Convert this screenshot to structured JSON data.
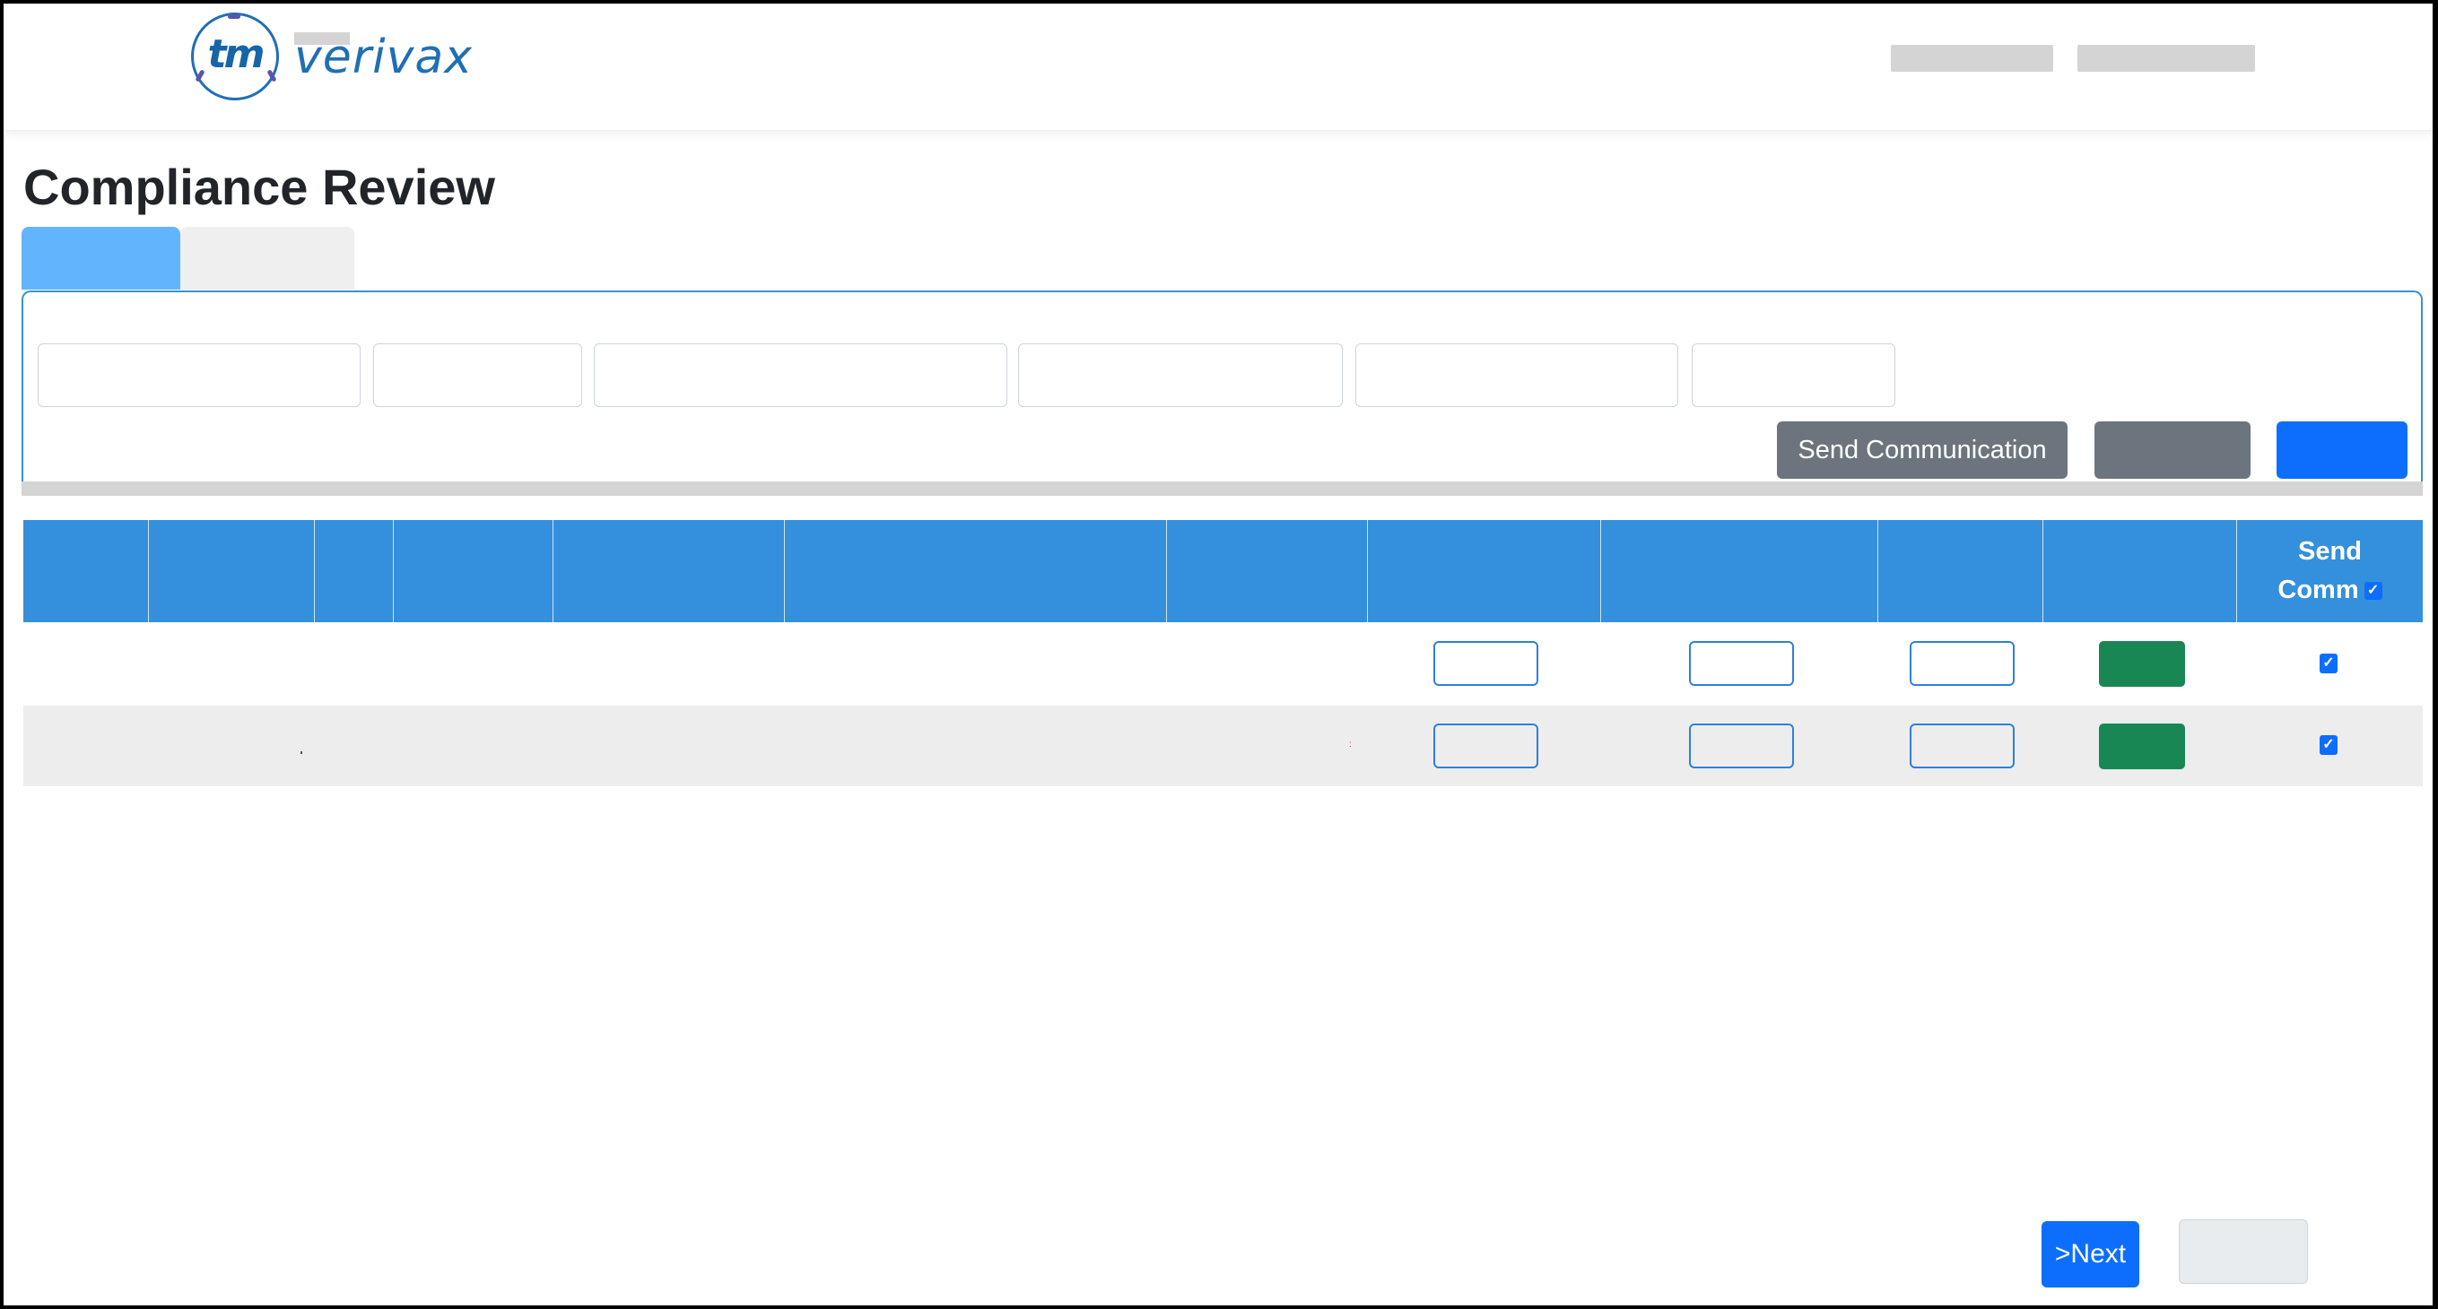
{
  "header": {
    "logo_mark": "tm",
    "logo_text": "verivax",
    "nav_items_redacted": 2
  },
  "page": {
    "title": "Compliance Review"
  },
  "tabs": [
    {
      "label": "",
      "active": true
    },
    {
      "label": "",
      "active": false
    }
  ],
  "filters": {
    "fields": [
      {
        "value": "",
        "placeholder": ""
      },
      {
        "value": "",
        "placeholder": ""
      },
      {
        "value": "",
        "placeholder": ""
      },
      {
        "value": "",
        "placeholder": ""
      },
      {
        "value": "",
        "placeholder": ""
      },
      {
        "value": "",
        "placeholder": ""
      }
    ],
    "buttons": {
      "send_communication": "Send Communication",
      "secondary": "",
      "primary": ""
    }
  },
  "table": {
    "columns": [
      "",
      "",
      "",
      "",
      "",
      "",
      "",
      "",
      "",
      "",
      "",
      "Send Comm"
    ],
    "send_comm_header": {
      "line1": "Send",
      "line2": "Comm",
      "select_all_checked": true
    },
    "rows": [
      {
        "inputs": [
          "",
          "",
          ""
        ],
        "action_label": "",
        "send_comm": true
      },
      {
        "inputs": [
          "",
          "",
          ""
        ],
        "action_label": "",
        "send_comm": true
      }
    ]
  },
  "footer": {
    "next_label": ">Next",
    "other_label": ""
  },
  "colors": {
    "primary": "#0d6efd",
    "header_blue": "#3490dc",
    "tab_active": "#62b5fd",
    "secondary": "#6c757d",
    "success": "#198754",
    "logo_blue": "#1f6fb5"
  },
  "icons": {
    "checkbox_checked": "✓"
  }
}
